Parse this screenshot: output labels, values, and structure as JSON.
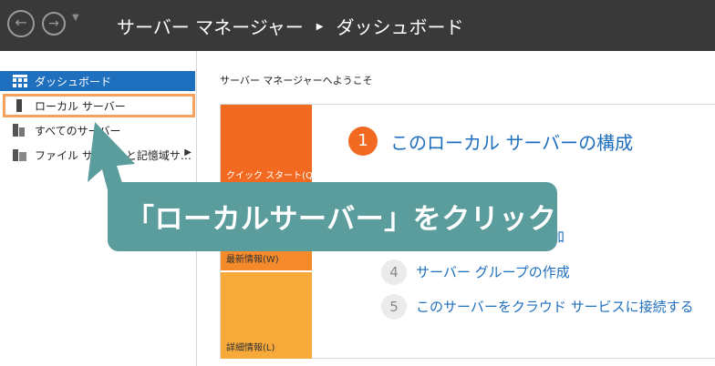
{
  "titlebar": {
    "app": "サーバー マネージャー",
    "page": "ダッシュボード",
    "back_icon": "back-arrow-icon",
    "forward_icon": "forward-arrow-icon"
  },
  "sidebar": {
    "items": [
      {
        "label": "ダッシュボード",
        "icon": "dashboard-icon",
        "active": true
      },
      {
        "label": "ローカル サーバー",
        "icon": "server-icon",
        "active": false
      },
      {
        "label": "すべてのサーバー",
        "icon": "servers-icon",
        "active": false
      },
      {
        "label": "ファイル サービスと記憶域サ…",
        "icon": "file-services-icon",
        "active": false
      }
    ]
  },
  "main": {
    "welcome": "サーバー マネージャーへようこそ",
    "tiles": {
      "quick_start": "クイック スタート(Q)",
      "news": "最新情報(W)",
      "details": "詳細情報(L)"
    },
    "step1": {
      "num": "1",
      "text": "このローカル サーバーの構成"
    },
    "step_partial": "加",
    "step4": {
      "num": "4",
      "text": "サーバー グループの作成"
    },
    "step5": {
      "num": "5",
      "text": "このサーバーをクラウド サービスに接続する"
    }
  },
  "callout": {
    "text": "「ローカルサーバー」をクリック",
    "color": "#5b9c9c"
  },
  "colors": {
    "accent": "#1f6fbf",
    "highlight": "#f7a25c",
    "quick_start": "#f26a21"
  }
}
